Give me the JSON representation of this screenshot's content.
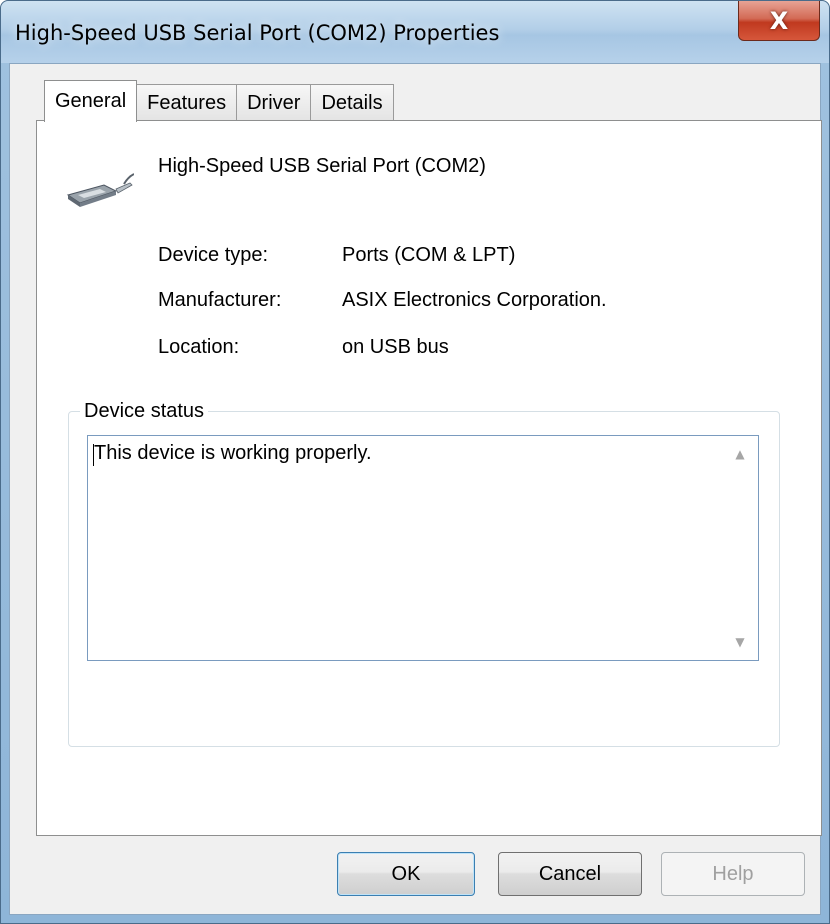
{
  "window": {
    "title": "High-Speed USB Serial Port (COM2) Properties",
    "close_label": "X"
  },
  "tabs": [
    {
      "label": "General",
      "active": true
    },
    {
      "label": "Features",
      "active": false
    },
    {
      "label": "Driver",
      "active": false
    },
    {
      "label": "Details",
      "active": false
    }
  ],
  "device": {
    "icon": "usb-cable-icon",
    "name": "High-Speed USB Serial Port (COM2)",
    "properties": [
      {
        "label": "Device type:",
        "value": "Ports (COM & LPT)"
      },
      {
        "label": "Manufacturer:",
        "value": "ASIX Electronics Corporation."
      },
      {
        "label": "Location:",
        "value": "on USB bus"
      }
    ]
  },
  "status": {
    "legend": "Device status",
    "text": "This device is working properly."
  },
  "buttons": {
    "ok": "OK",
    "cancel": "Cancel",
    "help": "Help"
  },
  "colors": {
    "close_button": "#c0391f",
    "default_button_border": "#3c7fb1"
  }
}
